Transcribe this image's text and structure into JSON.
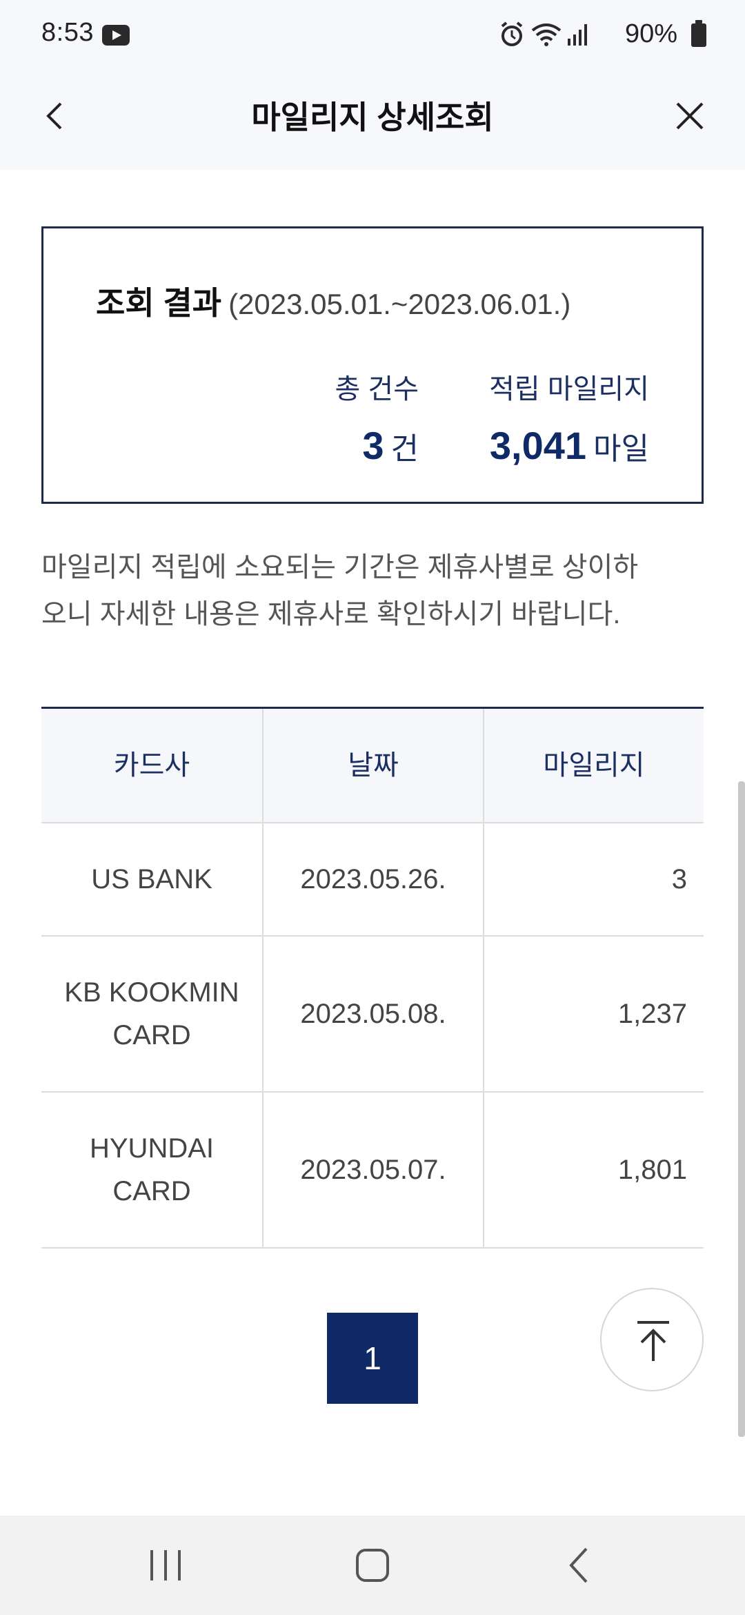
{
  "status_bar": {
    "time": "8:53",
    "battery_pct": "90%",
    "icons": [
      "youtube-icon",
      "alarm-icon",
      "wifi-icon",
      "signal-icon",
      "battery-icon"
    ]
  },
  "header": {
    "title": "마일리지 상세조회",
    "back_icon": "chevron-left-icon",
    "close_icon": "close-icon"
  },
  "result": {
    "title": "조회 결과",
    "range": "(2023.05.01.~2023.06.01.)",
    "count_label": "총 건수",
    "count_value": "3",
    "count_unit": "건",
    "miles_label": "적립 마일리지",
    "miles_value": "3,041",
    "miles_unit": "마일"
  },
  "notice": "마일리지 적립에 소요되는 기간은 제휴사별로 상이하오니 자세한 내용은 제휴사로 확인하시기 바랍니다.",
  "table": {
    "headers": [
      "카드사",
      "날짜",
      "마일리지"
    ],
    "rows": [
      {
        "card": "US BANK",
        "date": "2023.05.26.",
        "miles": "3"
      },
      {
        "card": "KB KOOKMIN CARD",
        "date": "2023.05.08.",
        "miles": "1,237"
      },
      {
        "card": "HYUNDAI CARD",
        "date": "2023.05.07.",
        "miles": "1,801"
      }
    ]
  },
  "pagination": {
    "current_page": "1"
  },
  "colors": {
    "navy": "#0f2a66",
    "border": "#1e2a4a",
    "header_bg": "#f6f8fc"
  }
}
